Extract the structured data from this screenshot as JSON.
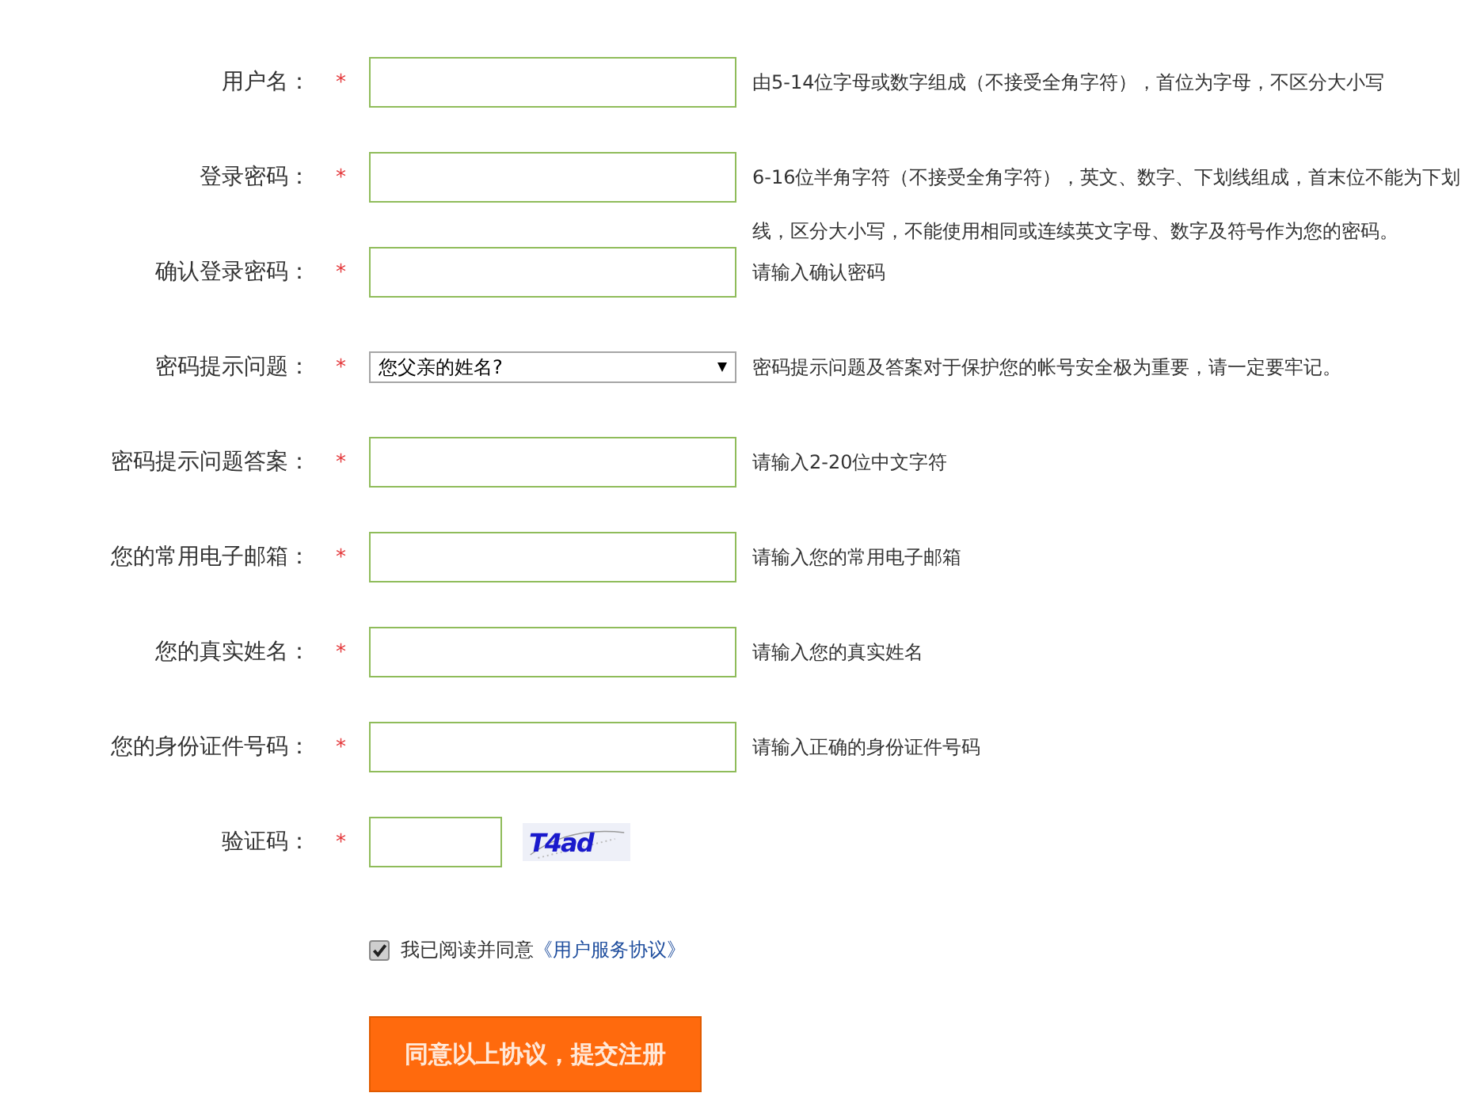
{
  "fields": [
    {
      "kind": "text",
      "label": "用户名：",
      "required": "*",
      "hint": "由5-14位字母或数字组成（不接受全角字符），首位为字母，不区分大小写"
    },
    {
      "kind": "text",
      "label": "登录密码：",
      "required": "*",
      "hint": "6-16位半角字符（不接受全角字符），英文、数字、下划线组成，首末位不能为下划线，区分大小写，不能使用相同或连续英文字母、数字及符号作为您的密码。"
    },
    {
      "kind": "text",
      "label": "确认登录密码：",
      "required": "*",
      "hint": "请输入确认密码"
    },
    {
      "kind": "select",
      "label": "密码提示问题：",
      "required": "*",
      "value": "您父亲的姓名?",
      "hint": "密码提示问题及答案对于保护您的帐号安全极为重要，请一定要牢记。"
    },
    {
      "kind": "text",
      "label": "密码提示问题答案：",
      "required": "*",
      "hint": "请输入2-20位中文字符"
    },
    {
      "kind": "text",
      "label": "您的常用电子邮箱：",
      "required": "*",
      "hint": "请输入您的常用电子邮箱"
    },
    {
      "kind": "text",
      "label": "您的真实姓名：",
      "required": "*",
      "hint": "请输入您的真实姓名"
    },
    {
      "kind": "text",
      "label": "您的身份证件号码：",
      "required": "*",
      "hint": "请输入正确的身份证件号码"
    },
    {
      "kind": "captcha",
      "label": "验证码：",
      "required": "*",
      "captcha": "T4ad"
    }
  ],
  "agreement": {
    "checked": true,
    "text": "我已阅读并同意",
    "link": "《用户服务协议》"
  },
  "submit": "同意以上协议，提交注册"
}
